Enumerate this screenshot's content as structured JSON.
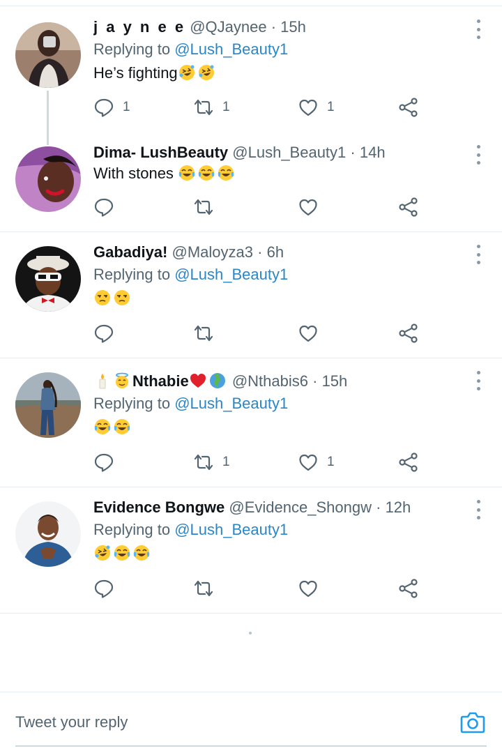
{
  "tweets": [
    {
      "name": "j a y n e e",
      "handle": "@QJaynee",
      "separator": "·",
      "time": "15h",
      "replying_prefix": "Replying to",
      "replying_to": "@Lush_Beauty1",
      "text": "He’s fighting",
      "text_emojis": [
        "rofl-emoji",
        "rofl-emoji"
      ],
      "reply_count": "1",
      "retweet_count": "1",
      "like_count": "1"
    },
    {
      "name": "Dima- LushBeauty",
      "handle": "@Lush_Beauty1",
      "separator": "·",
      "time": "14h",
      "text": "With stones",
      "text_emojis": [
        "joy-emoji",
        "joy-emoji",
        "joy-emoji"
      ],
      "reply_count": "",
      "retweet_count": "",
      "like_count": ""
    },
    {
      "name": "Gabadiya!",
      "handle": "@Maloyza3",
      "separator": "·",
      "time": "6h",
      "replying_prefix": "Replying to",
      "replying_to": "@Lush_Beauty1",
      "text": "",
      "text_emojis": [
        "unamused-emoji",
        "unamused-emoji"
      ],
      "reply_count": "",
      "retweet_count": "",
      "like_count": ""
    },
    {
      "name": "Nthabie",
      "name_prefix_emojis": [
        "candle-emoji",
        "angel-emoji"
      ],
      "name_suffix_emojis": [
        "red-heart-emoji",
        "globe-emoji"
      ],
      "handle": "@Nthabis6",
      "separator": "·",
      "time": "15h",
      "replying_prefix": "Replying to",
      "replying_to": "@Lush_Beauty1",
      "text": "",
      "text_emojis": [
        "joy-emoji",
        "joy-emoji"
      ],
      "reply_count": "",
      "retweet_count": "1",
      "like_count": "1"
    },
    {
      "name": "Evidence Bongwe",
      "handle": "@Evidence_Shongw",
      "separator": "·",
      "time": "12h",
      "replying_prefix": "Replying to",
      "replying_to": "@Lush_Beauty1",
      "text": "",
      "text_emojis": [
        "rofl-emoji",
        "joy-emoji",
        "joy-emoji"
      ],
      "reply_count": "",
      "retweet_count": "",
      "like_count": ""
    }
  ],
  "icons": {
    "reply": "comment-icon",
    "retweet": "retweet-icon",
    "like": "heart-icon",
    "share": "share-icon",
    "more": "more-vertical-icon",
    "camera": "camera-icon"
  },
  "composer": {
    "placeholder": "Tweet your reply"
  },
  "colors": {
    "link": "#2a86c5",
    "secondary_text": "#536471",
    "divider": "#e6ecf0",
    "camera": "#1d9bf0"
  }
}
